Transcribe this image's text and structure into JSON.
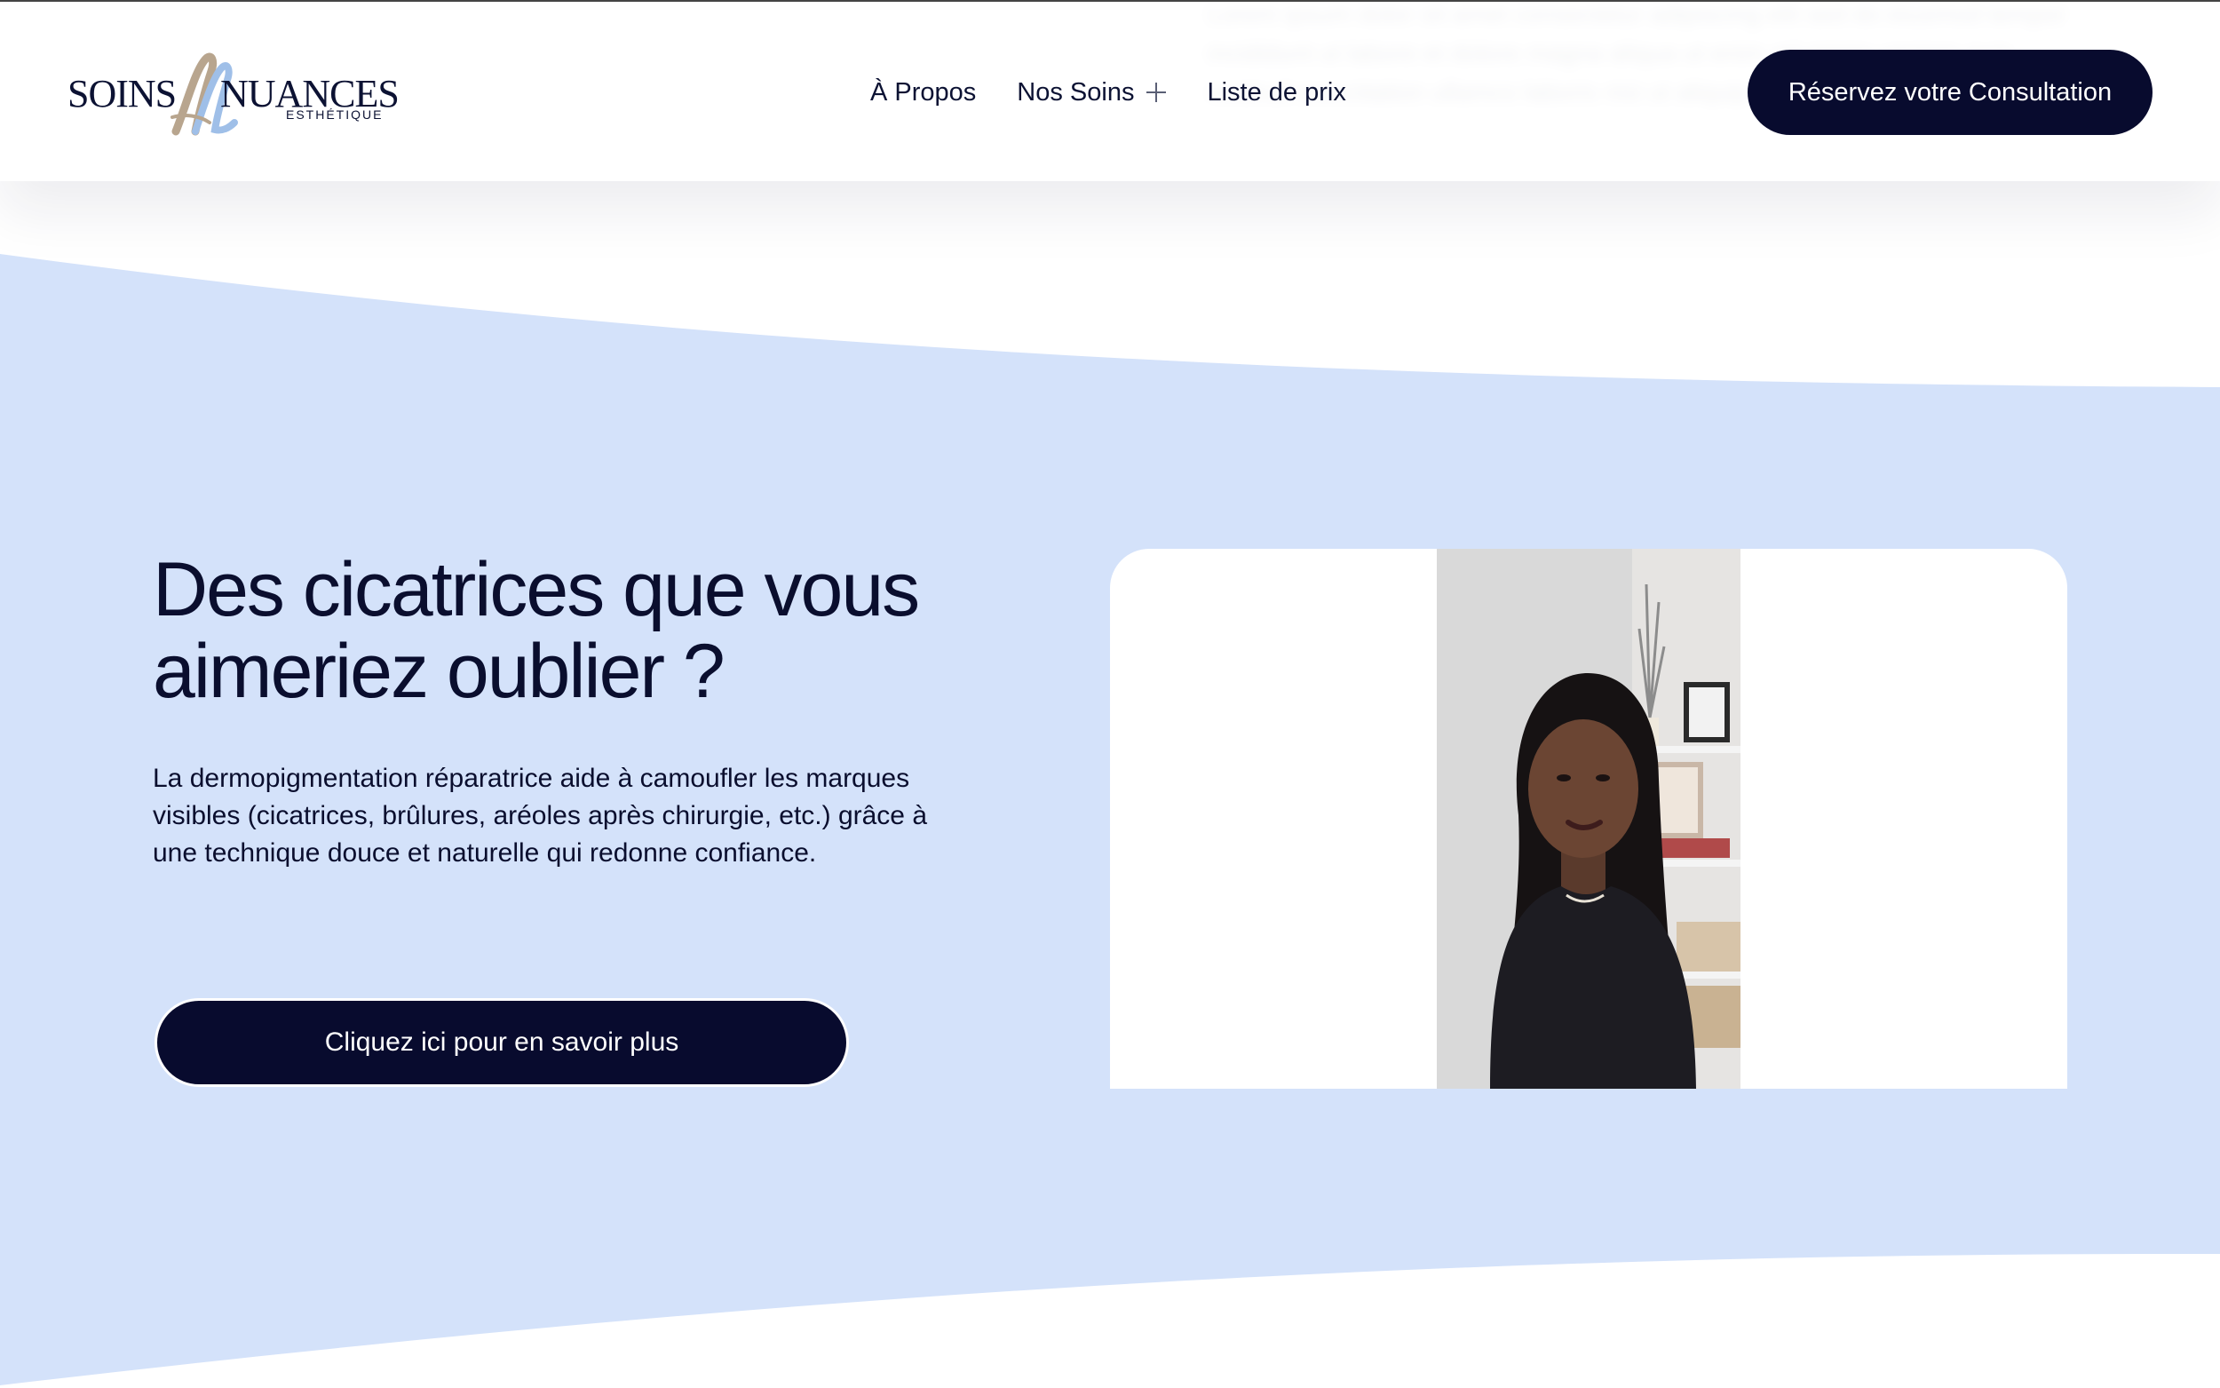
{
  "header": {
    "logo": {
      "word_left": "SOINS",
      "word_right": "NUANCES",
      "subtitle": "ESTHÉTIQUE"
    },
    "nav": [
      {
        "label": "À Propos",
        "has_submenu": false
      },
      {
        "label": "Nos Soins",
        "has_submenu": true,
        "icon": "plus-icon"
      },
      {
        "label": "Liste de prix",
        "has_submenu": false
      }
    ],
    "cta_label": "Réservez votre Consultation"
  },
  "hero": {
    "title": "Des cicatrices que vous aimeriez oublier ?",
    "description": "La dermopigmentation réparatrice aide à camoufler les marques visibles (cicatrices, brûlures, aréoles après chirurgie, etc.) grâce à une technique douce et naturelle qui redonne confiance.",
    "cta_label": "Cliquez ici pour en savoir plus"
  },
  "colors": {
    "accent_dark": "#080b2e",
    "section_background": "#d4e2fa",
    "text": "#0a0e2e",
    "logo_tan": "#b8a58e",
    "logo_blue": "#9fbfe8"
  }
}
